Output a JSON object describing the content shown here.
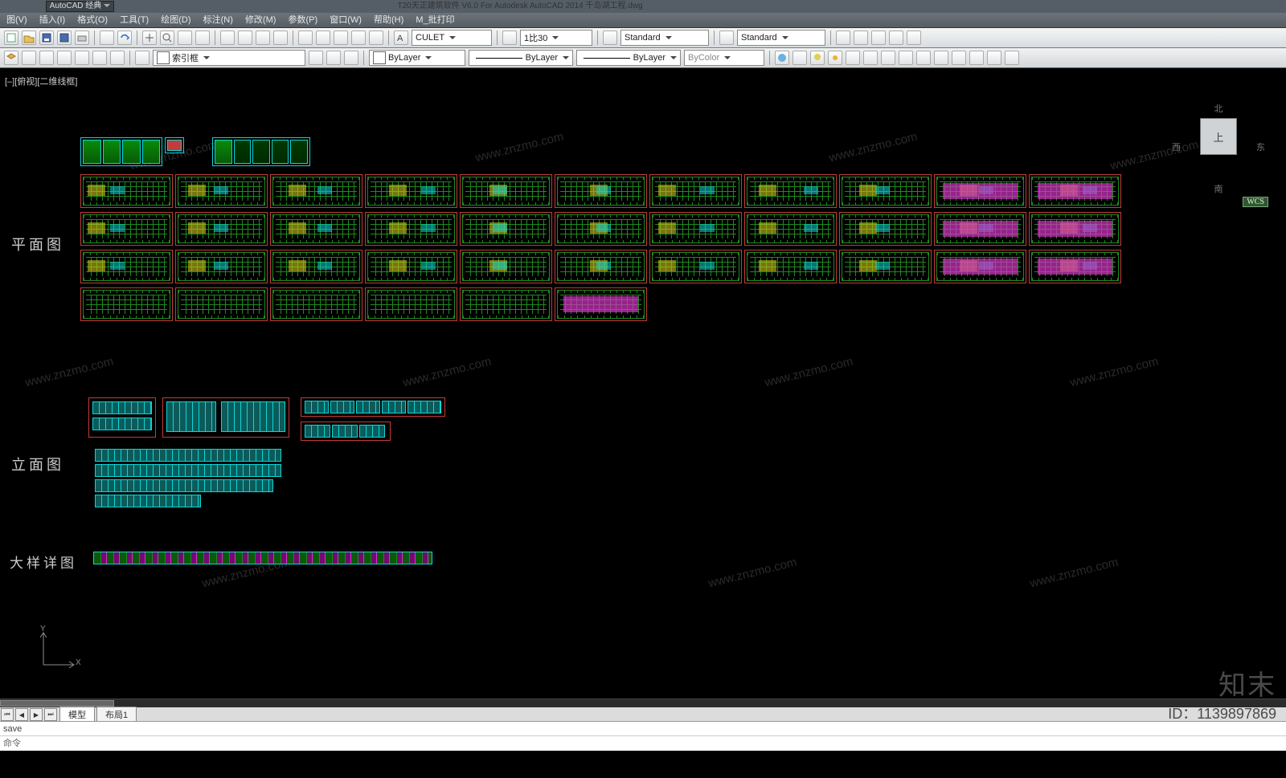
{
  "title": {
    "workspace": "AutoCAD 经典",
    "center": "T20天正建筑软件 V6.0 For Autodesk AutoCAD 2014  千岛湖工程.dwg"
  },
  "menu": [
    "图(V)",
    "插入(I)",
    "格式(O)",
    "工具(T)",
    "绘图(D)",
    "标注(N)",
    "修改(M)",
    "参数(P)",
    "窗口(W)",
    "帮助(H)",
    "M_批打印"
  ],
  "ribbon1": {
    "textstyle": "CULET",
    "dimscale": "1比30",
    "dimstyle": "Standard",
    "tablestyle": "Standard"
  },
  "ribbon2": {
    "layer_filter": "索引框",
    "layer_color": "#d8a018",
    "color_control": "ByLayer",
    "linetype": "ByLayer",
    "lineweight": "ByLayer",
    "plotstyle": "ByColor"
  },
  "viewport_label": "[–][俯视][二维线框]",
  "sections": {
    "plan": "平面图",
    "elev": "立面图",
    "detail": "大样详图"
  },
  "navcube": {
    "n": "北",
    "s": "南",
    "e": "东",
    "w": "西",
    "face": "上"
  },
  "wcs": "WCS",
  "ucs": {
    "y": "Y",
    "x": "X"
  },
  "tabs": {
    "model": "模型",
    "layout": "布局1"
  },
  "cmd": {
    "line1": "save",
    "line2": "命令"
  },
  "watermark": {
    "host": "www.znzmo.com",
    "brand": "知末",
    "id": "ID：1139897869"
  },
  "icons": {
    "sheet": "drawing-sheet",
    "legend": "legend-table",
    "elev": "elevation-row",
    "detail": "detail-row",
    "new": "new-icon",
    "open": "open-icon",
    "save": "save-icon",
    "undo": "undo-icon",
    "redo": "redo-icon",
    "pan": "pan-icon",
    "zoom": "zoom-extents-icon",
    "layeriso": "layer-iso-icon",
    "layers": "layers-panel-icon",
    "text": "text-style-icon",
    "dim": "dim-style-icon",
    "table": "table-style-icon",
    "brush": "format-paint-icon",
    "layerflt": "layer-filter-icon",
    "layermgr": "layer-manager-icon",
    "match": "match-props-icon",
    "sun": "sun-icon",
    "bulb": "bulb-icon",
    "freeze": "freeze-icon",
    "lock": "lock-icon"
  }
}
